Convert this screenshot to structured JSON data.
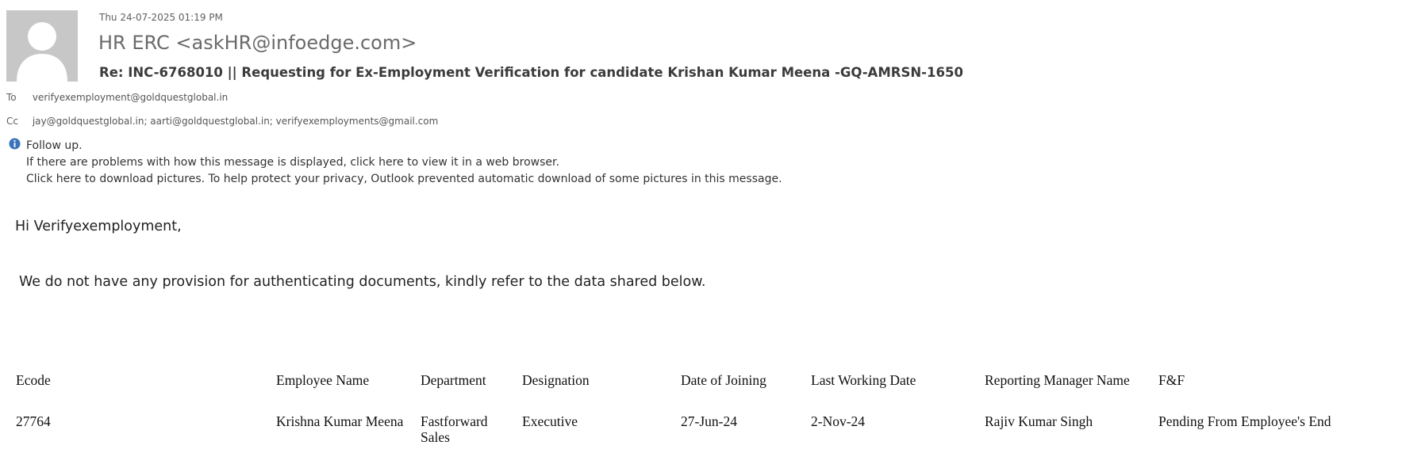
{
  "email": {
    "date": "Thu 24-07-2025 01:19 PM",
    "from": "HR ERC <askHR@infoedge.com>",
    "subject": "Re: INC-6768010 || Requesting for Ex-Employment Verification for candidate Krishan Kumar Meena -GQ-AMRSN-1650",
    "to_label": "To",
    "to": "verifyexemployment@goldquestglobal.in",
    "cc_label": "Cc",
    "cc": "jay@goldquestglobal.in; aarti@goldquestglobal.in; verifyexemployments@gmail.com"
  },
  "infobar": {
    "icon": "info-icon",
    "follow_up": "Follow up.",
    "view_browser": "If there are problems with how this message is displayed, click here to view it in a web browser.",
    "download_pictures": "Click here to download pictures. To help protect your privacy, Outlook prevented automatic download of some pictures in this message."
  },
  "body": {
    "greeting": "Hi Verifyexemployment,",
    "message": "We do not have any provision for authenticating documents, kindly refer to the data shared below."
  },
  "table": {
    "headers": [
      "Ecode",
      "Employee Name",
      "Department",
      "Designation",
      "Date of Joining",
      "Last Working Date",
      "Reporting Manager Name",
      "F&F"
    ],
    "rows": [
      [
        "27764",
        "Krishna Kumar Meena",
        "Fastforward Sales",
        "Executive",
        "27-Jun-24",
        "2-Nov-24",
        "Rajiv Kumar Singh",
        "Pending From Employee's End"
      ]
    ]
  }
}
